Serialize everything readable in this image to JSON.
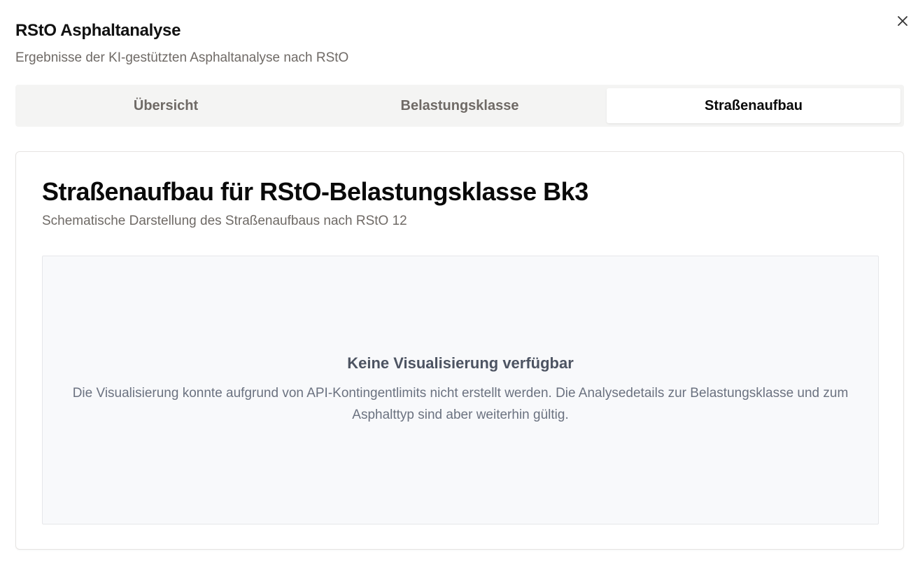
{
  "dialog": {
    "title": "RStO Asphaltanalyse",
    "subtitle": "Ergebnisse der KI-gestützten Asphaltanalyse nach RStO",
    "close_icon": "close-icon"
  },
  "tabs": [
    {
      "label": "Übersicht",
      "active": false
    },
    {
      "label": "Belastungsklasse",
      "active": false
    },
    {
      "label": "Straßenaufbau",
      "active": true
    }
  ],
  "card": {
    "title": "Straßenaufbau für RStO-Belastungsklasse Bk3",
    "subtitle": "Schematische Darstellung des Straßenaufbaus nach RStO 12",
    "placeholder": {
      "title": "Keine Visualisierung verfügbar",
      "text": "Die Visualisierung konnte aufgrund von API-Kontingentlimits nicht erstellt werden. Die Analysedetails zur Belastungsklasse und zum Asphalttyp sind aber weiterhin gültig."
    }
  }
}
